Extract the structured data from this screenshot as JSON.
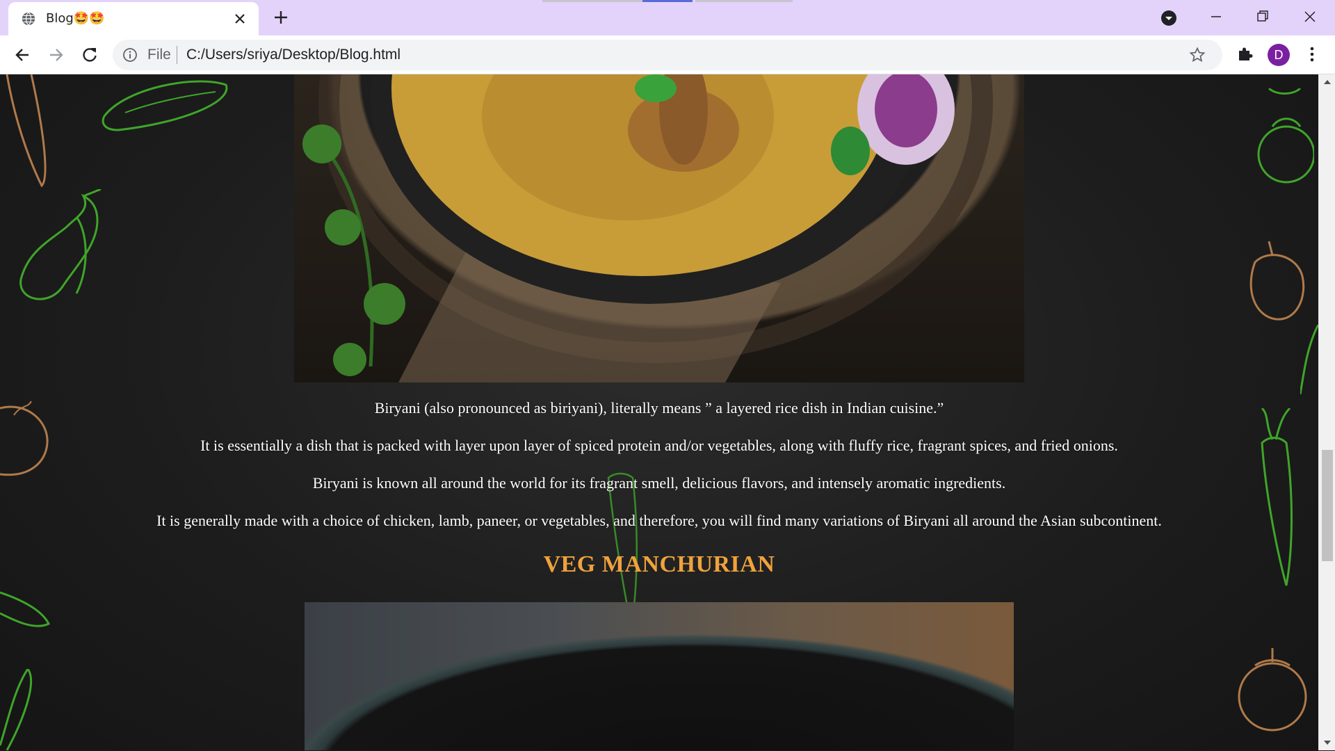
{
  "browser": {
    "tab_title": "Blog🤩🤩",
    "omnibox_scheme": "File",
    "url": "C:/Users/sriya/Desktop/Blog.html",
    "profile_initial": "D",
    "profile_color": "#7b1fa2",
    "tabstrip_color": "#e3d3fb"
  },
  "article": {
    "paragraphs": [
      "Biryani (also pronounced as biriyani), literally means ” a layered rice dish in Indian cuisine.”",
      "It is essentially a dish that is packed with layer upon layer of spiced protein and/or vegetables, along with fluffy rice, fragrant spices, and fried onions.",
      "Biryani is known all around the world for its fragrant smell, delicious flavors, and intensely aromatic ingredients.",
      "It is generally made with a choice of chicken, lamb, paneer, or vegetables, and therefore, you will find many variations of Biryani all around the Asian subcontinent."
    ],
    "next_heading": "VEG MANCHURIAN",
    "heading_color": "#f0a23c"
  },
  "icons": {
    "tab_favicon": "globe-icon",
    "tab_close": "close-icon",
    "new_tab": "plus-icon",
    "tab_search": "tab-search-icon",
    "minimize": "minimize-icon",
    "maximize": "restore-icon",
    "close_window": "close-window-icon",
    "back": "back-arrow-icon",
    "forward": "forward-arrow-icon",
    "reload": "reload-icon",
    "site_info": "info-icon",
    "bookmark": "star-icon",
    "extensions": "puzzle-icon",
    "menu": "kebab-menu-icon"
  }
}
